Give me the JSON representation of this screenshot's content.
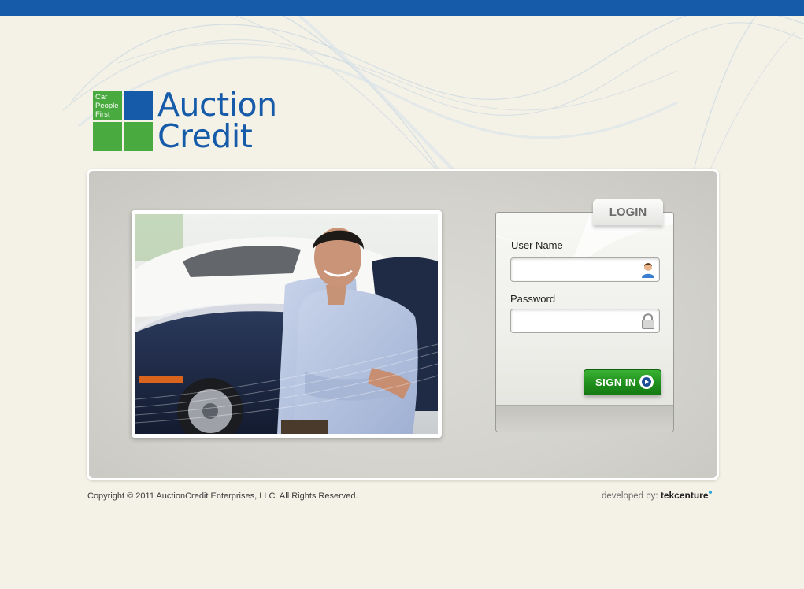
{
  "logo": {
    "tagline": [
      "Car",
      "People",
      "First"
    ],
    "word1": "Auction",
    "word2": "Credit",
    "colors": {
      "blue": "#165ba9",
      "green": "#49aa3f"
    }
  },
  "login": {
    "tab_label": "LOGIN",
    "username_label": "User Name",
    "username_value": "",
    "username_icon": "user-icon",
    "password_label": "Password",
    "password_value": "",
    "password_icon": "lock-icon",
    "signin_label": "SIGN IN",
    "signin_icon": "arrow-right-circle-icon"
  },
  "footer": {
    "copyright": "Copyright © 2011 AuctionCredit Enterprises, LLC. All Rights Reserved.",
    "developed_by": "developed by:",
    "developer": "tekcenture"
  },
  "colors": {
    "topbar": "#165ba9",
    "background": "#f4f1e7",
    "signin_green": "#1f8f1c"
  }
}
